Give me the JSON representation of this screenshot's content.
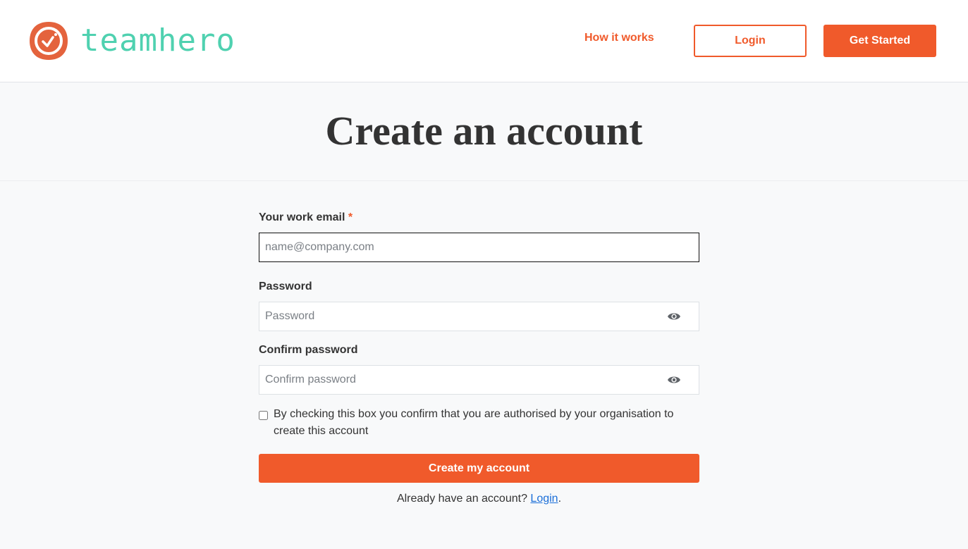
{
  "header": {
    "brand": "teamhero",
    "nav_link": "How it works",
    "login_label": "Login",
    "get_started_label": "Get Started"
  },
  "colors": {
    "accent": "#f05a2b",
    "brand_text": "#4fd1b0",
    "link": "#1a6ed8"
  },
  "page": {
    "title": "Create an account"
  },
  "form": {
    "email": {
      "label": "Your work email",
      "required_mark": "*",
      "placeholder": "name@company.com",
      "value": ""
    },
    "password": {
      "label": "Password",
      "placeholder": "Password",
      "value": "",
      "toggle_icon": "eye-icon"
    },
    "confirm": {
      "label": "Confirm password",
      "placeholder": "Confirm password",
      "value": "",
      "toggle_icon": "eye-icon"
    },
    "consent": {
      "text": "By checking this box you confirm that you are authorised by your organisation to create this account",
      "checked": false
    },
    "submit_label": "Create my account",
    "footer_prefix": "Already have an account?",
    "footer_link": "Login",
    "footer_suffix": "."
  }
}
